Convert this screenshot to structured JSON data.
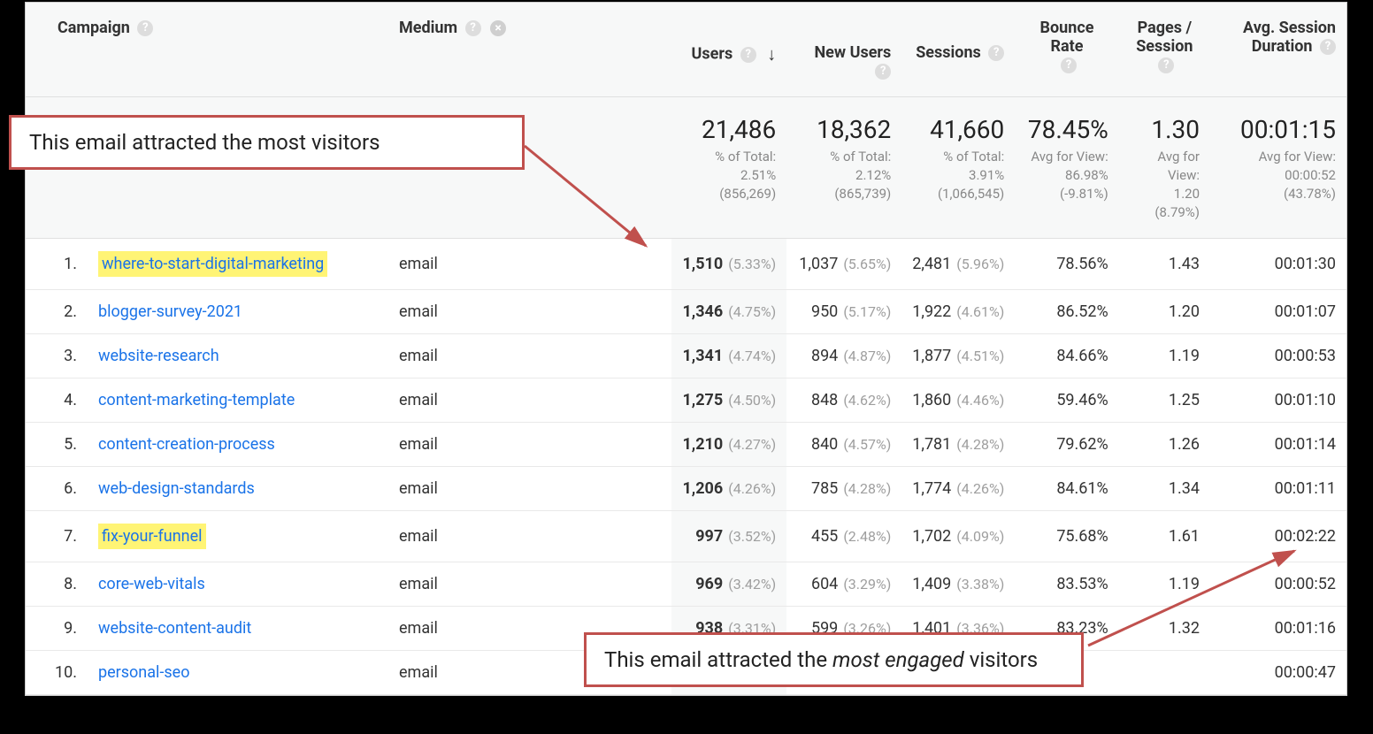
{
  "columns": {
    "campaign": "Campaign",
    "medium": "Medium",
    "users": "Users",
    "new_users": "New Users",
    "sessions": "Sessions",
    "bounce": "Bounce Rate",
    "pages": "Pages / Session",
    "duration": "Avg. Session Duration"
  },
  "totals": {
    "users": {
      "value": "21,486",
      "sub1": "% of Total:",
      "sub2": "2.51% (856,269)"
    },
    "new_users": {
      "value": "18,362",
      "sub1": "% of Total:",
      "sub2": "2.12% (865,739)"
    },
    "sessions": {
      "value": "41,660",
      "sub1": "% of Total:",
      "sub2": "3.91%",
      "sub3": "(1,066,545)"
    },
    "bounce": {
      "value": "78.45%",
      "sub1": "Avg for View:",
      "sub2": "86.98%",
      "sub3": "(-9.81%)"
    },
    "pages": {
      "value": "1.30",
      "sub1": "Avg for",
      "sub2": "View:",
      "sub3": "1.20",
      "sub4": "(8.79%)"
    },
    "duration": {
      "value": "00:01:15",
      "sub1": "Avg for View:",
      "sub2": "00:00:52",
      "sub3": "(43.78%)"
    }
  },
  "rows": [
    {
      "idx": "1.",
      "campaign": "where-to-start-digital-marketing",
      "highlight": true,
      "medium": "email",
      "users": "1,510",
      "users_pct": "(5.33%)",
      "new_users": "1,037",
      "new_users_pct": "(5.65%)",
      "sessions": "2,481",
      "sessions_pct": "(5.96%)",
      "bounce": "78.56%",
      "pages": "1.43",
      "duration": "00:01:30"
    },
    {
      "idx": "2.",
      "campaign": "blogger-survey-2021",
      "highlight": false,
      "medium": "email",
      "users": "1,346",
      "users_pct": "(4.75%)",
      "new_users": "950",
      "new_users_pct": "(5.17%)",
      "sessions": "1,922",
      "sessions_pct": "(4.61%)",
      "bounce": "86.52%",
      "pages": "1.20",
      "duration": "00:01:07"
    },
    {
      "idx": "3.",
      "campaign": "website-research",
      "highlight": false,
      "medium": "email",
      "users": "1,341",
      "users_pct": "(4.74%)",
      "new_users": "894",
      "new_users_pct": "(4.87%)",
      "sessions": "1,877",
      "sessions_pct": "(4.51%)",
      "bounce": "84.66%",
      "pages": "1.19",
      "duration": "00:00:53"
    },
    {
      "idx": "4.",
      "campaign": "content-marketing-template",
      "highlight": false,
      "medium": "email",
      "users": "1,275",
      "users_pct": "(4.50%)",
      "new_users": "848",
      "new_users_pct": "(4.62%)",
      "sessions": "1,860",
      "sessions_pct": "(4.46%)",
      "bounce": "59.46%",
      "pages": "1.25",
      "duration": "00:01:10"
    },
    {
      "idx": "5.",
      "campaign": "content-creation-process",
      "highlight": false,
      "medium": "email",
      "users": "1,210",
      "users_pct": "(4.27%)",
      "new_users": "840",
      "new_users_pct": "(4.57%)",
      "sessions": "1,781",
      "sessions_pct": "(4.28%)",
      "bounce": "79.62%",
      "pages": "1.26",
      "duration": "00:01:14"
    },
    {
      "idx": "6.",
      "campaign": "web-design-standards",
      "highlight": false,
      "medium": "email",
      "users": "1,206",
      "users_pct": "(4.26%)",
      "new_users": "785",
      "new_users_pct": "(4.28%)",
      "sessions": "1,774",
      "sessions_pct": "(4.26%)",
      "bounce": "84.61%",
      "pages": "1.34",
      "duration": "00:01:11"
    },
    {
      "idx": "7.",
      "campaign": "fix-your-funnel",
      "highlight": true,
      "medium": "email",
      "users": "997",
      "users_pct": "(3.52%)",
      "new_users": "455",
      "new_users_pct": "(2.48%)",
      "sessions": "1,702",
      "sessions_pct": "(4.09%)",
      "bounce": "75.68%",
      "pages": "1.61",
      "duration": "00:02:22"
    },
    {
      "idx": "8.",
      "campaign": "core-web-vitals",
      "highlight": false,
      "medium": "email",
      "users": "969",
      "users_pct": "(3.42%)",
      "new_users": "604",
      "new_users_pct": "(3.29%)",
      "sessions": "1,409",
      "sessions_pct": "(3.38%)",
      "bounce": "83.53%",
      "pages": "1.19",
      "duration": "00:00:52"
    },
    {
      "idx": "9.",
      "campaign": "website-content-audit",
      "highlight": false,
      "medium": "email",
      "users": "938",
      "users_pct": "(3.31%)",
      "new_users": "599",
      "new_users_pct": "(3.26%)",
      "sessions": "1,401",
      "sessions_pct": "(3.36%)",
      "bounce": "83.23%",
      "pages": "1.32",
      "duration": "00:01:16"
    },
    {
      "idx": "10.",
      "campaign": "personal-seo",
      "highlight": false,
      "medium": "email",
      "users": "",
      "users_pct": "",
      "new_users": "",
      "new_users_pct": "",
      "sessions": "",
      "sessions_pct": "",
      "bounce": "",
      "pages": "",
      "duration": "00:00:47"
    }
  ],
  "callouts": {
    "top": "This email attracted the most visitors",
    "bottom_prefix": "This email attracted the ",
    "bottom_em": "most engaged",
    "bottom_suffix": " visitors"
  }
}
